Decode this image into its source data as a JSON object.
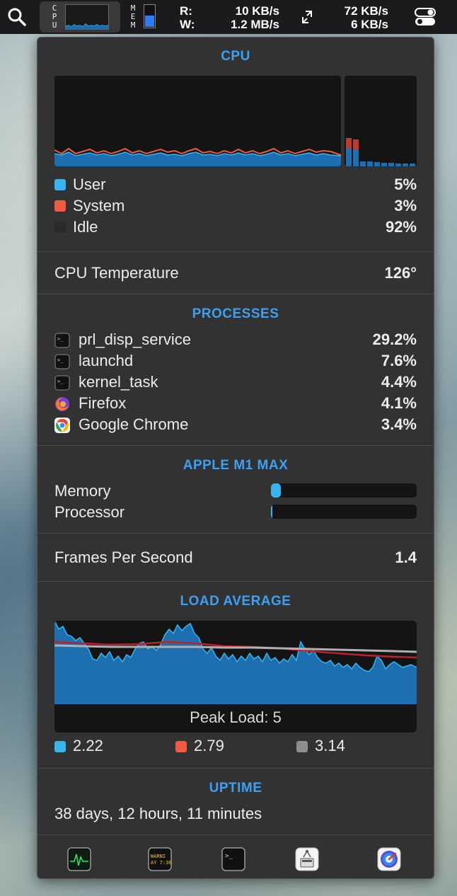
{
  "menubar": {
    "cpu_label": [
      "C",
      "P",
      "U"
    ],
    "mem_label": [
      "M",
      "E",
      "M"
    ],
    "disk_read_label": "R:",
    "disk_write_label": "W:",
    "disk_read_value": "10 KB/s",
    "disk_write_value": "1.2 MB/s",
    "net_in_value": "72 KB/s",
    "net_out_value": "6 KB/s",
    "memory_fill_fraction": 0.5
  },
  "cpu": {
    "title": "CPU",
    "legend": [
      {
        "label": "User",
        "value": "5%",
        "color": "#36b5ef"
      },
      {
        "label": "System",
        "value": "3%",
        "color": "#f05a43"
      },
      {
        "label": "Idle",
        "value": "92%",
        "color": "#2a2a2a"
      }
    ]
  },
  "temperature": {
    "label": "CPU Temperature",
    "value": "126°"
  },
  "processes": {
    "title": "PROCESSES",
    "items": [
      {
        "name": "prl_disp_service",
        "value": "29.2%",
        "icon": "terminal-icon"
      },
      {
        "name": "launchd",
        "value": "7.6%",
        "icon": "terminal-icon"
      },
      {
        "name": "kernel_task",
        "value": "4.4%",
        "icon": "terminal-icon"
      },
      {
        "name": "Firefox",
        "value": "4.1%",
        "icon": "firefox-icon"
      },
      {
        "name": "Google Chrome",
        "value": "3.4%",
        "icon": "chrome-icon"
      }
    ]
  },
  "gpu": {
    "title": "APPLE M1 MAX",
    "memory_label": "Memory",
    "processor_label": "Processor",
    "memory_fraction": 0.07,
    "processor_fraction": 0.01
  },
  "fps": {
    "label": "Frames Per Second",
    "value": "1.4"
  },
  "load": {
    "title": "LOAD AVERAGE",
    "peak_label": "Peak Load: 5",
    "legend": [
      {
        "value": "2.22",
        "color": "#36b5ef"
      },
      {
        "value": "2.79",
        "color": "#f05a43"
      },
      {
        "value": "3.14",
        "color": "#8e8e8e"
      }
    ]
  },
  "uptime": {
    "title": "UPTIME",
    "value": "38 days, 12 hours, 11 minutes"
  },
  "dock": [
    "activity-monitor-icon",
    "console-icon",
    "terminal-icon",
    "system-info-icon",
    "disk-utility-icon"
  ]
}
